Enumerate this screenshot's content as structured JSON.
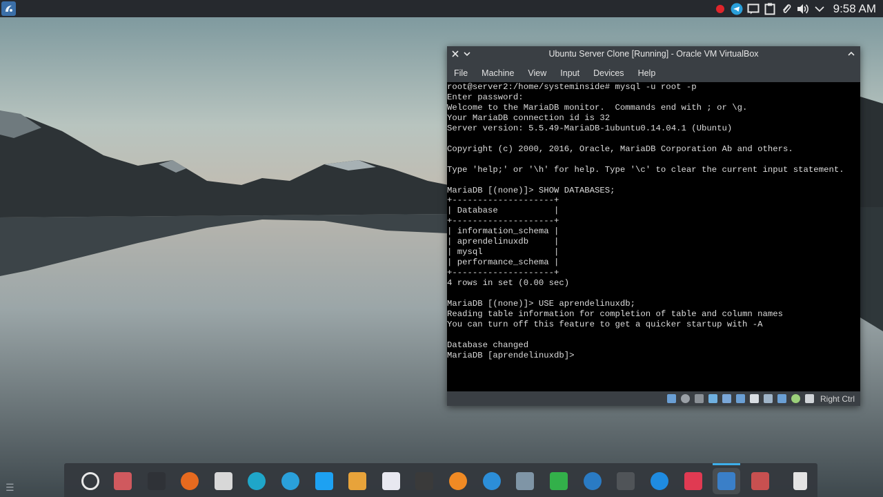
{
  "top_panel": {
    "launcher_icon": "kde-launcher-icon",
    "tray_icons": [
      "record-indicator-icon",
      "telegram-icon",
      "message-icon",
      "clipboard-icon",
      "attachment-icon",
      "volume-icon",
      "chevron-down-icon"
    ],
    "clock": "9:58 AM"
  },
  "window": {
    "title": "Ubuntu Server Clone [Running] - Oracle VM VirtualBox",
    "menu": [
      "File",
      "Machine",
      "View",
      "Input",
      "Devices",
      "Help"
    ],
    "console_lines": [
      "root@server2:/home/systeminside# mysql -u root -p",
      "Enter password:",
      "Welcome to the MariaDB monitor.  Commands end with ; or \\g.",
      "Your MariaDB connection id is 32",
      "Server version: 5.5.49-MariaDB-1ubuntu0.14.04.1 (Ubuntu)",
      "",
      "Copyright (c) 2000, 2016, Oracle, MariaDB Corporation Ab and others.",
      "",
      "Type 'help;' or '\\h' for help. Type '\\c' to clear the current input statement.",
      "",
      "MariaDB [(none)]> SHOW DATABASES;",
      "+--------------------+",
      "| Database           |",
      "+--------------------+",
      "| information_schema |",
      "| aprendelinuxdb     |",
      "| mysql              |",
      "| performance_schema |",
      "+--------------------+",
      "4 rows in set (0.00 sec)",
      "",
      "MariaDB [(none)]> USE aprendelinuxdb;",
      "Reading table information for completion of table and column names",
      "You can turn off this feature to get a quicker startup with -A",
      "",
      "Database changed",
      "MariaDB [aprendelinuxdb]>"
    ],
    "status_icons": [
      "hard-disk-icon",
      "optical-drive-icon",
      "audio-icon",
      "network-icon",
      "usb-icon",
      "shared-folder-icon",
      "display-icon",
      "video-capture-icon",
      "cpu-icon",
      "mouse-integration-icon",
      "keyboard-icon"
    ],
    "host_key": "Right Ctrl"
  },
  "dock": {
    "menu_glyph": "☰",
    "items": [
      {
        "name": "kde-menu-icon",
        "color": "#e8e8e8"
      },
      {
        "name": "files-icon",
        "color": "#d0595e"
      },
      {
        "name": "terminal-icon",
        "color": "#2f3237"
      },
      {
        "name": "firefox-icon",
        "color": "#e66a1f"
      },
      {
        "name": "mail-icon",
        "color": "#d8d8d8"
      },
      {
        "name": "gitkraken-icon",
        "color": "#1fa6c9"
      },
      {
        "name": "telegram-icon",
        "color": "#2aa0da"
      },
      {
        "name": "twitter-icon",
        "color": "#1da1f2"
      },
      {
        "name": "sublime-text-icon",
        "color": "#e8a33a"
      },
      {
        "name": "document-icon",
        "color": "#e8e8f0"
      },
      {
        "name": "inkscape-icon",
        "color": "#3a3a3a"
      },
      {
        "name": "vlc-icon",
        "color": "#f08a24"
      },
      {
        "name": "blue-sphere-icon",
        "color": "#2c8ed8"
      },
      {
        "name": "screenshot-icon",
        "color": "#7f95a6"
      },
      {
        "name": "spreadsheet-icon",
        "color": "#33b04a"
      },
      {
        "name": "kdeconnect-icon",
        "color": "#2a7bc4"
      },
      {
        "name": "headphones-icon",
        "color": "#505458"
      },
      {
        "name": "edge-browser-icon",
        "color": "#1f8be0"
      },
      {
        "name": "dice-icon",
        "color": "#e03a52"
      },
      {
        "name": "virtualbox-icon",
        "color": "#3a7fc8"
      },
      {
        "name": "screen-recorder-icon",
        "color": "#c85050"
      },
      {
        "name": "trash-icon",
        "color": "#e4e4e4"
      }
    ]
  }
}
